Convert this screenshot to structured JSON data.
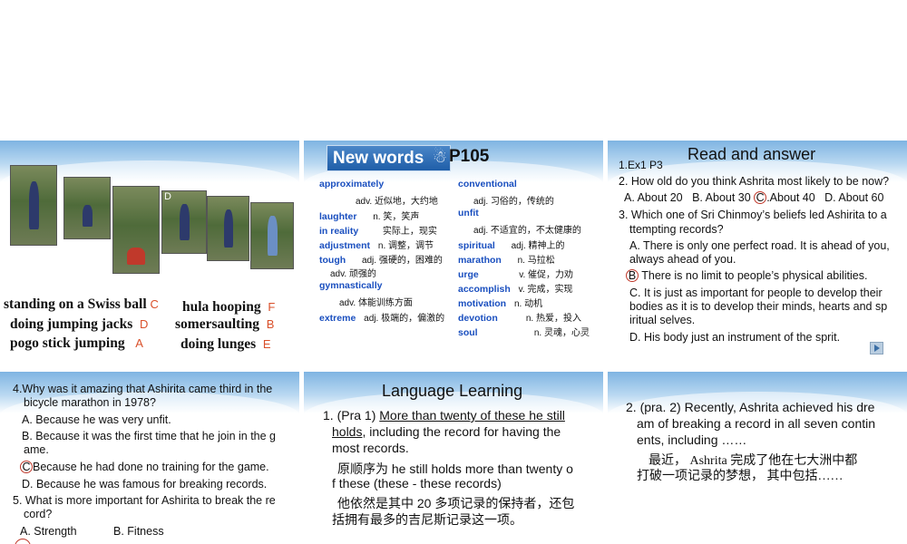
{
  "slide1": {
    "photo_label": "D",
    "activities": [
      {
        "text": "standing on a Swiss ball",
        "letter": "C"
      },
      {
        "text": "doing jumping jacks",
        "letter": "D"
      },
      {
        "text": "pogo stick jumping",
        "letter": "A"
      },
      {
        "text": "hula hooping",
        "letter": "F"
      },
      {
        "text": "somersaulting",
        "letter": "B"
      },
      {
        "text": "doing lunges",
        "letter": "E"
      }
    ]
  },
  "slide2": {
    "badge": "New words",
    "page": "P105",
    "left_col": [
      {
        "en": "approximately",
        "cn": ""
      },
      {
        "en": "",
        "cn": "adv. 近似地，大约地"
      },
      {
        "en": "laughter",
        "cn": "n. 笑，笑声"
      },
      {
        "en": "in reality",
        "cn": "实际上，现实"
      },
      {
        "en": "adjustment",
        "cn": "n. 调整，调节"
      },
      {
        "en": "tough",
        "cn": "adj. 强硬的，困难的"
      },
      {
        "en": "",
        "cn": "adv. 顽强的"
      },
      {
        "en": "gymnastically",
        "cn": ""
      },
      {
        "en": "",
        "cn": "adv. 体能训练方面"
      },
      {
        "en": "extreme",
        "cn": "adj. 极端的，偏激的"
      }
    ],
    "right_col": [
      {
        "en": "conventional",
        "cn": ""
      },
      {
        "en": "",
        "cn": "adj. 习俗的，传统的"
      },
      {
        "en": "unfit",
        "cn": ""
      },
      {
        "en": "",
        "cn": "adj. 不适宜的，不太健康的"
      },
      {
        "en": "spiritual",
        "cn": "adj. 精神上的"
      },
      {
        "en": "marathon",
        "cn": "n. 马拉松"
      },
      {
        "en": "urge",
        "cn": "v. 催促，力劝"
      },
      {
        "en": "accomplish",
        "cn": "v. 完成，实现"
      },
      {
        "en": "motivation",
        "cn": "n. 动机"
      },
      {
        "en": "devotion",
        "cn": "n. 热爱，投入"
      },
      {
        "en": "soul",
        "cn": "n. 灵魂，心灵"
      }
    ]
  },
  "slide3": {
    "title": "Read and answer",
    "ref": "1.Ex1  P3",
    "q2": "2. How old do you think Ashrita most likely to be now?",
    "q2_opts": [
      "A. About 20",
      "B. About 30",
      "C",
      ".About 40",
      "D. About 60"
    ],
    "q3_l1": "3. Which one of Sri Chinmoy’s beliefs led Ashirita to a",
    "q3_l2": "ttempting records?",
    "a1": "A. There is only one perfect road. It is ahead of you,",
    "a2": "always ahead of you.",
    "b_letter": "B",
    "b_text": "There is no limit to people’s physical abilities.",
    "c1": "C. It is just as important for people to develop their",
    "c2": "bodies as it is to develop their minds, hearts and sp",
    "c3": "iritual selves.",
    "d1": "D. His body just an instrument of the sprit."
  },
  "slide4": {
    "q4_l1": "4.Why was it amazing that Ashirita came third in the",
    "q4_l2": "bicycle marathon in 1978?",
    "a": "A. Because he was very unfit.",
    "b1": "B. Because it was the first time that he join in the g",
    "b2": "ame.",
    "c_letter": "C",
    "c_text": "Because he had done no training for the game.",
    "d": "D. Because he was famous for breaking records.",
    "q5_l1": "5. What is more important for Ashirita to break the re",
    "q5_l2": "cord?",
    "q5_a": "A. Strength",
    "q5_b": "B. Fitness"
  },
  "slide5": {
    "title": "Language Learning",
    "l1_prefix": "1. (Pra 1) ",
    "l1_underlined": "More than twenty of these he still",
    "l2_underlined": "holds",
    "l2_rest": ", including the record for having the",
    "l3": "most records.",
    "l4": "原顺序为 he still holds more than twenty o",
    "l5": "f these  (these - these records)",
    "l6": "他依然是其中 20 多项记录的保持者，还包",
    "l7": "括拥有最多的吉尼斯记录这一项。"
  },
  "slide6": {
    "l1": "2. (pra. 2) Recently, Ashrita achieved his dre",
    "l2": "am of breaking a record in all seven contin",
    "l3": "ents, including ……",
    "l4": "最近，   Ashrita 完成了他在七大洲中都",
    "l5": "打破一项记录的梦想，  其中包括……"
  }
}
